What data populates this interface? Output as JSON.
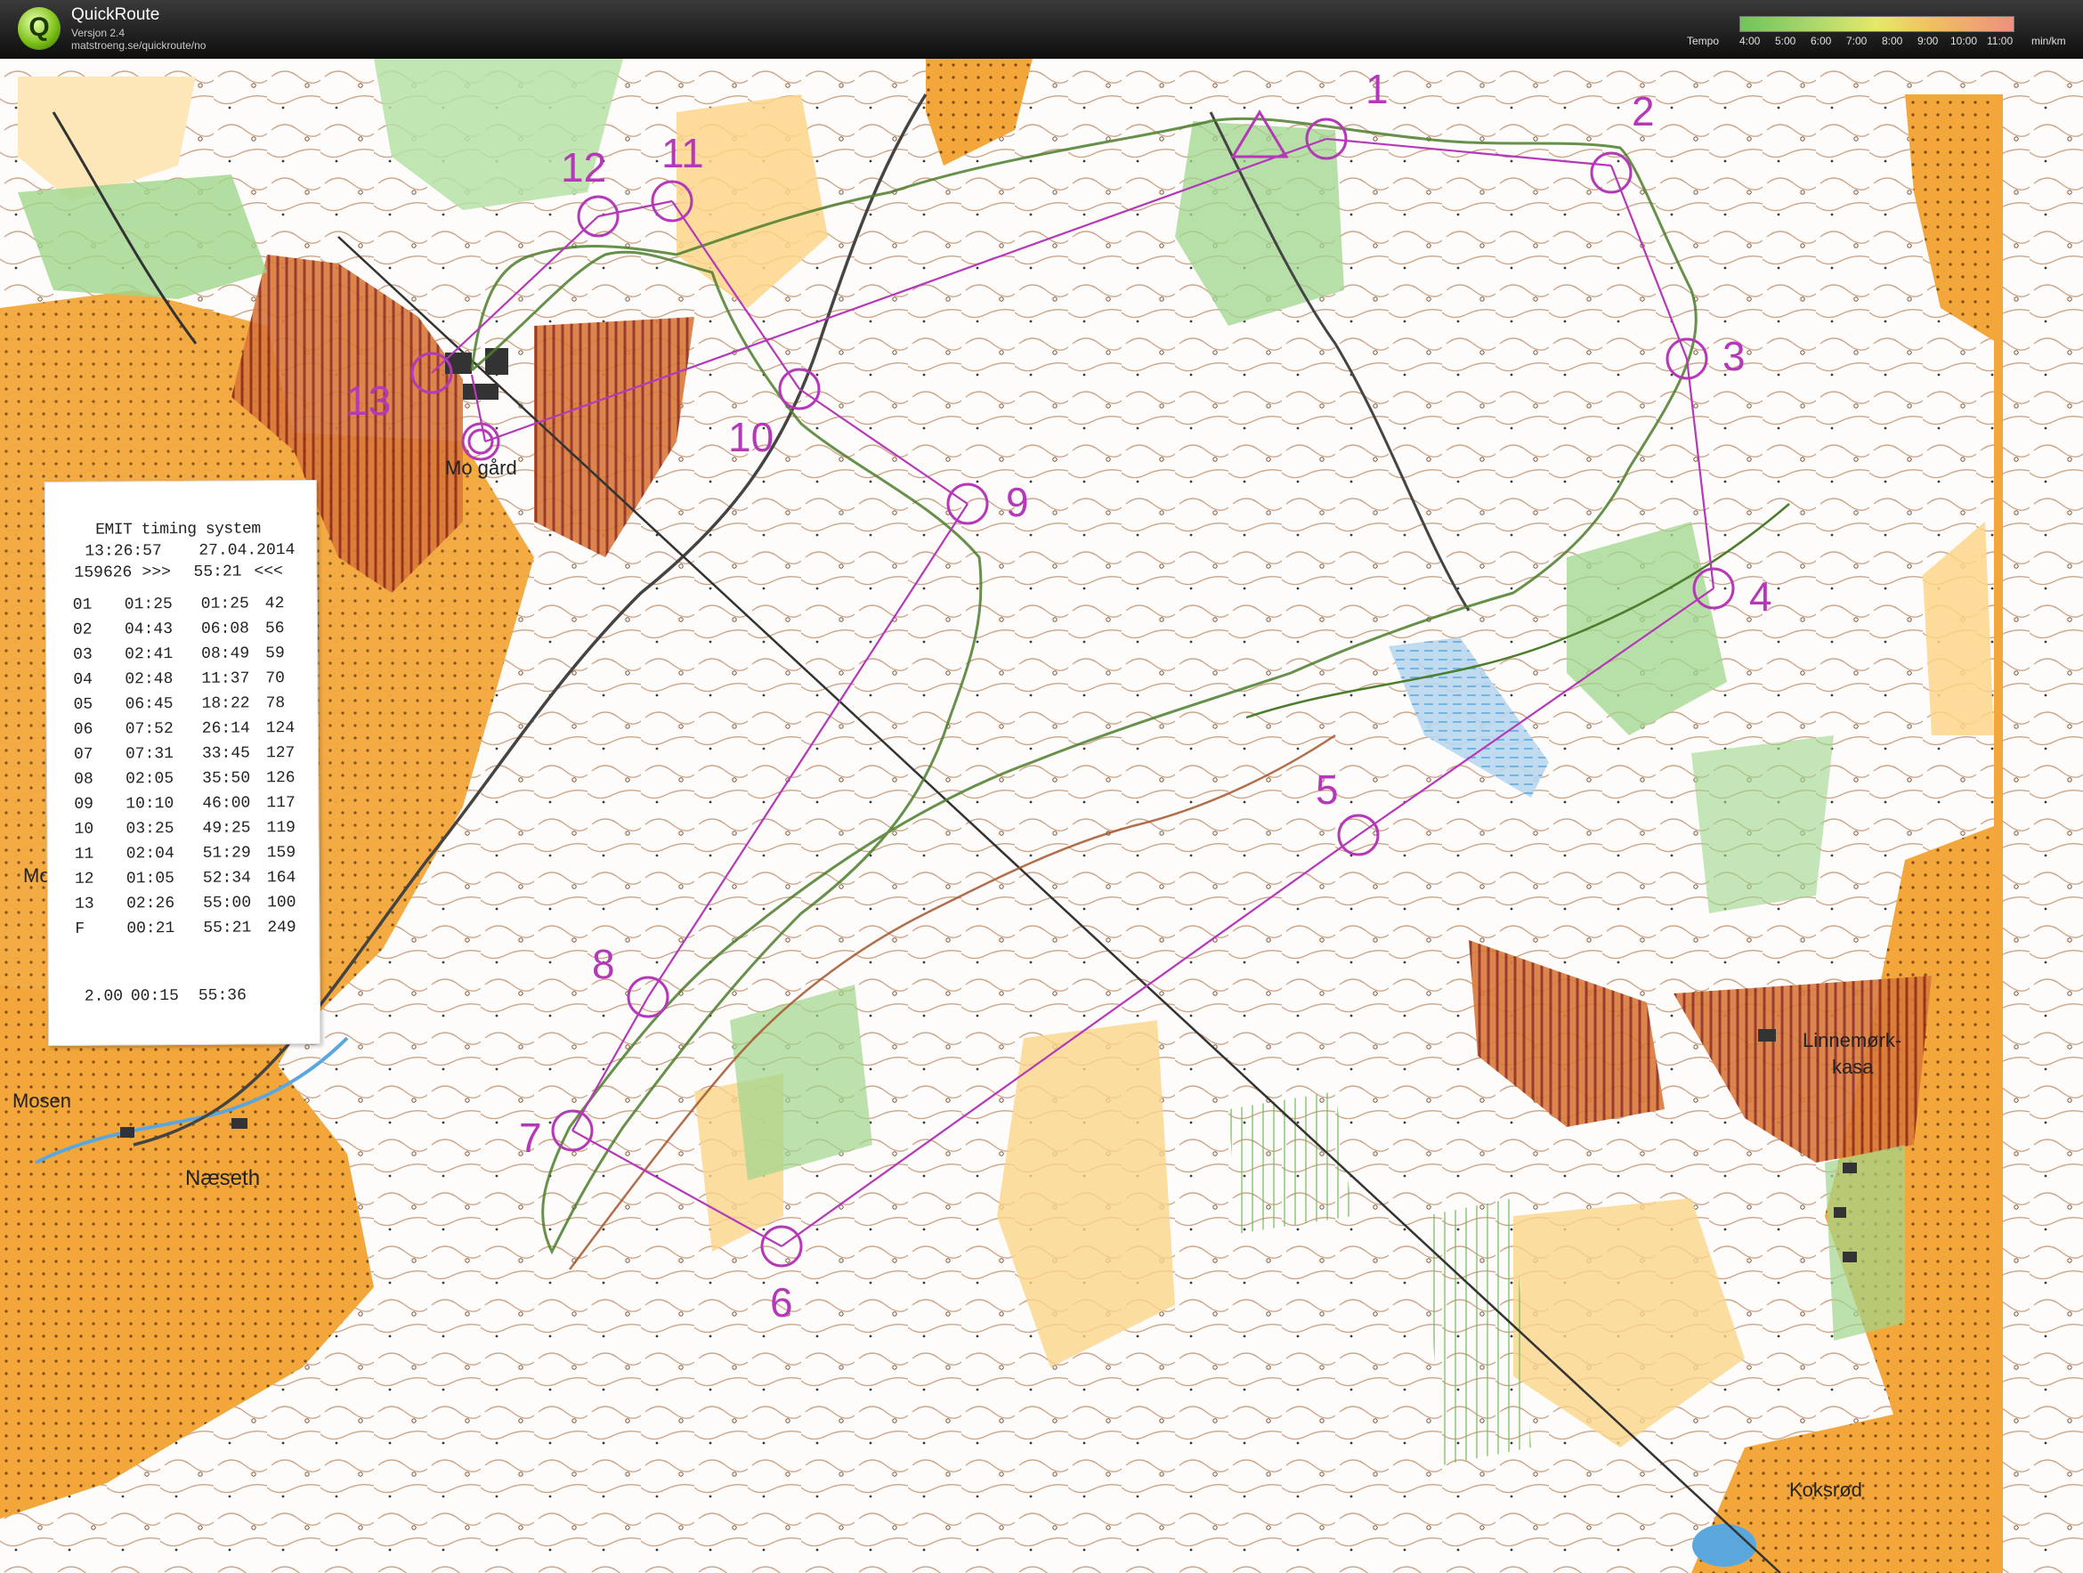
{
  "app": {
    "logo_letter": "Q",
    "title": "QuickRoute",
    "version": "Versjon 2.4",
    "url": "matstroeng.se/quickroute/no"
  },
  "tempo_scale": {
    "label": "Tempo",
    "ticks": [
      "4:00",
      "5:00",
      "6:00",
      "7:00",
      "8:00",
      "9:00",
      "10:00",
      "11:00"
    ],
    "unit": "min/km",
    "colors": {
      "fast": "#6fc35a",
      "mid": "#e6e86a",
      "slow": "#ef8f7f"
    }
  },
  "map": {
    "place_names": {
      "mo_gard": "Mo gård",
      "mol": "Mol",
      "mosen": "Mosen",
      "naeseth": "Næseth",
      "linnemork_1": "Linnemørk-",
      "linnemork_2": "kasa",
      "koksrod": "Koksrød"
    },
    "controls": [
      "1",
      "2",
      "3",
      "4",
      "5",
      "6",
      "7",
      "8",
      "9",
      "10",
      "11",
      "12",
      "13"
    ],
    "colors": {
      "open_land": "#f3a73a",
      "rough_open": "#fbd58a",
      "cultivated": "#cf6a3a",
      "forest_green": "#9fd68c",
      "course_purple": "#b438b8",
      "contour_brown": "#a4683a",
      "water_blue": "#5aa7de",
      "route_green": "#4c7d2c"
    }
  },
  "receipt": {
    "title": "EMIT timing system",
    "time": "13:26:57",
    "date": "27.04.2014",
    "card_id": "159626",
    "arrows_left": ">>>",
    "total": "55:21",
    "arrows_right": "<<<",
    "rows": [
      [
        "01",
        "01:25",
        "01:25",
        "42"
      ],
      [
        "02",
        "04:43",
        "06:08",
        "56"
      ],
      [
        "03",
        "02:41",
        "08:49",
        "59"
      ],
      [
        "04",
        "02:48",
        "11:37",
        "70"
      ],
      [
        "05",
        "06:45",
        "18:22",
        "78"
      ],
      [
        "06",
        "07:52",
        "26:14",
        "124"
      ],
      [
        "07",
        "07:31",
        "33:45",
        "127"
      ],
      [
        "08",
        "02:05",
        "35:50",
        "126"
      ],
      [
        "09",
        "10:10",
        "46:00",
        "117"
      ],
      [
        "10",
        "03:25",
        "49:25",
        "119"
      ],
      [
        "11",
        "02:04",
        "51:29",
        "159"
      ],
      [
        "12",
        "01:05",
        "52:34",
        "164"
      ],
      [
        "13",
        "02:26",
        "55:00",
        "100"
      ],
      [
        "F",
        "00:21",
        "55:21",
        "249"
      ]
    ],
    "footer": [
      "2.00",
      "00:15",
      "55:36"
    ]
  }
}
